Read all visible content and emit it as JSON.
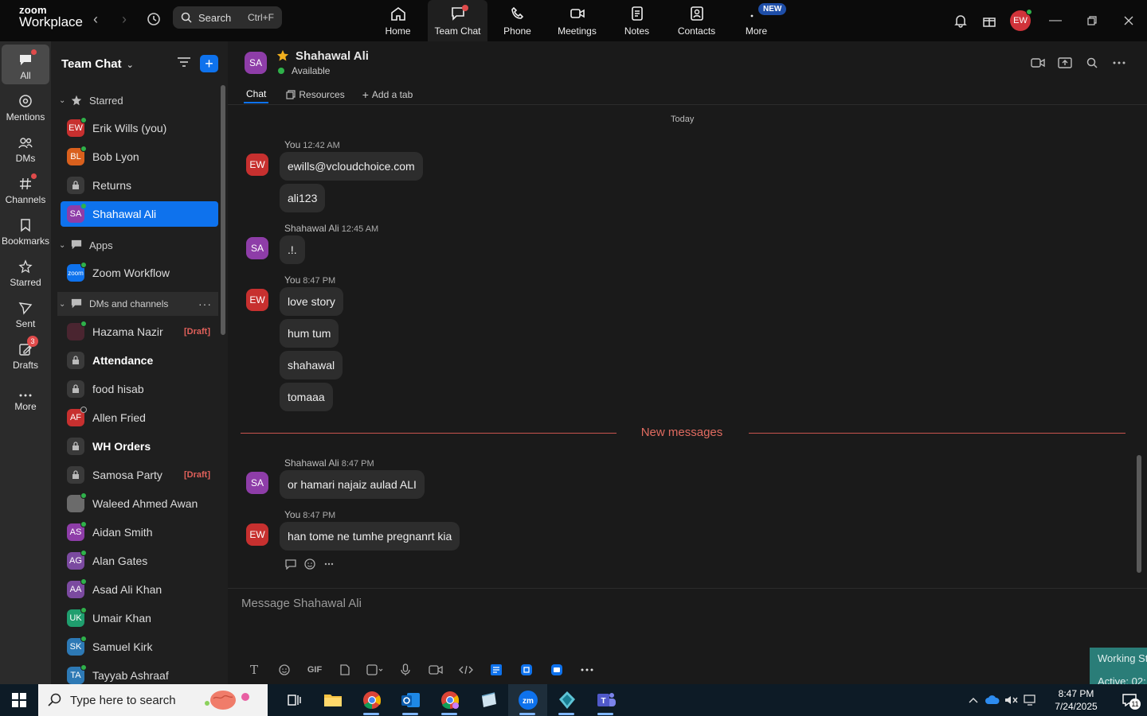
{
  "app": {
    "logo_line1": "zoom",
    "logo_line2": "Workplace"
  },
  "search": {
    "label": "Search",
    "shortcut": "Ctrl+F"
  },
  "nav": [
    {
      "label": "Home"
    },
    {
      "label": "Team Chat",
      "active": true
    },
    {
      "label": "Phone"
    },
    {
      "label": "Meetings"
    },
    {
      "label": "Notes"
    },
    {
      "label": "Contacts"
    },
    {
      "label": "More",
      "badge": "NEW"
    }
  ],
  "user": {
    "initials": "EW"
  },
  "rail": [
    {
      "label": "All"
    },
    {
      "label": "Mentions"
    },
    {
      "label": "DMs"
    },
    {
      "label": "Channels"
    },
    {
      "label": "Bookmarks"
    },
    {
      "label": "Starred"
    },
    {
      "label": "Sent"
    },
    {
      "label": "Drafts",
      "count": "3"
    },
    {
      "label": "More"
    }
  ],
  "sidebar": {
    "title": "Team Chat",
    "sections": {
      "starred": "Starred",
      "apps": "Apps",
      "dms": "DMs and channels"
    },
    "starred_items": [
      {
        "initials": "EW",
        "name": "Erik Wills (you)",
        "color": "#c7302f"
      },
      {
        "initials": "BL",
        "name": "Bob Lyon",
        "color": "#d9601d"
      },
      {
        "name": "Returns"
      },
      {
        "initials": "SA",
        "name": "Shahawal Ali",
        "color": "#8e3da8"
      }
    ],
    "apps_items": [
      {
        "initials": "zoom",
        "name": "Zoom Workflow",
        "color": "#0e72ed"
      }
    ],
    "dm_items": [
      {
        "name": "Hazama Nazir",
        "draft": "[Draft]",
        "color": "#4a2530"
      },
      {
        "name": "Attendance"
      },
      {
        "name": "food hisab"
      },
      {
        "initials": "AF",
        "name": "Allen Fried",
        "color": "#c7302f"
      },
      {
        "name": "WH Orders"
      },
      {
        "name": "Samosa Party",
        "draft": "[Draft]"
      },
      {
        "name": "Waleed Ahmed Awan",
        "color": "#6b6b6b"
      },
      {
        "initials": "AS",
        "name": "Aidan Smith",
        "color": "#8e3da8"
      },
      {
        "initials": "AG",
        "name": "Alan Gates",
        "color": "#7b4aa0"
      },
      {
        "initials": "AA",
        "name": "Asad Ali Khan",
        "color": "#7b4aa0"
      },
      {
        "initials": "UK",
        "name": "Umair Khan",
        "color": "#1f9e6e"
      },
      {
        "initials": "SK",
        "name": "Samuel Kirk",
        "color": "#2d79b5"
      },
      {
        "initials": "TA",
        "name": "Tayyab Ashraaf",
        "color": "#2d79b5"
      }
    ]
  },
  "chat": {
    "initials": "SA",
    "name": "Shahawal Ali",
    "status": "Available",
    "tabs": [
      "Chat",
      "Resources",
      "Add a tab"
    ],
    "day": "Today",
    "groups": [
      {
        "initials": "EW",
        "sender": "You",
        "time": "12:42 AM",
        "messages": [
          "ewills@vcloudchoice.com",
          "ali123"
        ]
      },
      {
        "initials": "SA",
        "sender": "Shahawal Ali",
        "time": "12:45 AM",
        "messages": [
          ".!."
        ]
      },
      {
        "initials": "EW",
        "sender": "You",
        "time": "8:47 PM",
        "messages": [
          "love story",
          "hum tum",
          "shahawal",
          "tomaaa"
        ]
      },
      {
        "initials": "SA",
        "sender": "Shahawal Ali",
        "time": "8:47 PM",
        "messages": [
          "or hamari najaiz aulad ALI"
        ]
      },
      {
        "initials": "EW",
        "sender": "You",
        "time": "8:47 PM",
        "messages": [
          "han tome ne tumhe pregnanrt kia"
        ]
      }
    ],
    "new_messages": "New messages",
    "composer_placeholder": "Message Shahawal Ali",
    "composer_gif": "GIF"
  },
  "working": {
    "line1": "Working St",
    "line2": "Active: 02:1"
  },
  "taskbar": {
    "search_placeholder": "Type here to search",
    "time": "8:47 PM",
    "date": "7/24/2025",
    "notifications": "11"
  }
}
